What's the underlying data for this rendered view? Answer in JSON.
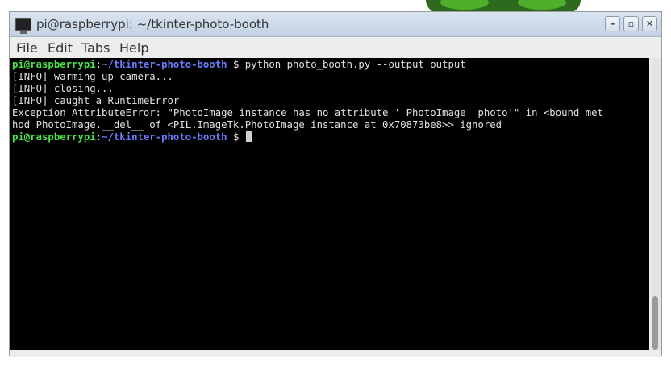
{
  "window": {
    "title": "pi@raspberrypi: ~/tkinter-photo-booth",
    "buttons": {
      "minimize": "–",
      "maximize": "▫",
      "close": "✕"
    }
  },
  "menu": {
    "items": [
      "File",
      "Edit",
      "Tabs",
      "Help"
    ]
  },
  "terminal": {
    "prompt_user": "pi@raspberrypi",
    "prompt_sep": ":",
    "prompt_path": "~/tkinter-photo-booth",
    "prompt_symbol": " $",
    "command": " python photo_booth.py --output output",
    "output": [
      "[INFO] warming up camera...",
      "[INFO] closing...",
      "[INFO] caught a RuntimeError",
      "Exception AttributeError: \"PhotoImage instance has no attribute '_PhotoImage__photo'\" in <bound met",
      "hod PhotoImage.__del__ of <PIL.ImageTk.PhotoImage instance at 0x70873be8>> ignored"
    ]
  },
  "icons": {
    "app": "terminal-icon",
    "minimize": "minimize-icon",
    "maximize": "maximize-icon",
    "close": "close-icon"
  },
  "colors": {
    "prompt_user": "#4ae34a",
    "prompt_path": "#6b7dff",
    "terminal_bg": "#000000",
    "titlebar": "#c9d6e6"
  }
}
